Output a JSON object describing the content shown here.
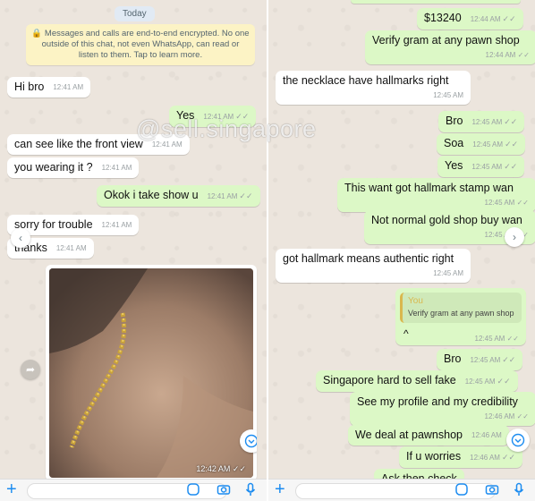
{
  "left": {
    "day_label": "Today",
    "encryption_notice": "Messages and calls are end-to-end encrypted. No one outside of this chat, not even WhatsApp, can read or listen to them. Tap to learn more.",
    "messages": [
      {
        "text": "Hi bro",
        "time": "12:41 AM"
      },
      {
        "text": "Yes",
        "time": "12:41 AM"
      },
      {
        "text": "can see like the front view",
        "time": "12:41 AM"
      },
      {
        "text": "you wearing it ?",
        "time": "12:41 AM"
      },
      {
        "text": "Okok i take show u",
        "time": "12:41 AM"
      },
      {
        "text": "sorry for trouble",
        "time": "12:41 AM"
      },
      {
        "text": "thanks",
        "time": "12:41 AM"
      }
    ],
    "photo_time": "12:42 AM"
  },
  "right": {
    "messages": [
      {
        "text": "$13240",
        "time": "12:44 AM"
      },
      {
        "text": "Verify gram at any pawn shop",
        "time": "12:44 AM"
      },
      {
        "text": "the necklace have hallmarks right",
        "time": "12:45 AM"
      },
      {
        "text": "Bro",
        "time": "12:45 AM"
      },
      {
        "text": "Soa",
        "time": "12:45 AM"
      },
      {
        "text": "Yes",
        "time": "12:45 AM"
      },
      {
        "text": "This want got hallmark stamp wan",
        "time": "12:45 AM"
      },
      {
        "text": "Not normal gold shop buy wan",
        "time": "12:45 AM"
      },
      {
        "text": "got hallmark means authentic right",
        "time": "12:45 AM"
      },
      {
        "text": "^",
        "time": "12:45 AM"
      },
      {
        "text": "Bro",
        "time": "12:45 AM"
      },
      {
        "text": "Singapore hard to sell fake",
        "time": "12:45 AM"
      },
      {
        "text": "See my profile and my credibility",
        "time": "12:46 AM"
      },
      {
        "text": "We deal at pawnshop",
        "time": "12:46 AM"
      },
      {
        "text": "If u worries",
        "time": "12:46 AM"
      },
      {
        "text": "Ask then check",
        "time": ""
      }
    ],
    "quote": {
      "author": "You",
      "text": "Verify gram at any pawn shop"
    }
  },
  "watermark": "@sell.singapore",
  "colors": {
    "outgoing": "#dcf8c6",
    "incoming": "#ffffff",
    "accent": "#1c8cf0"
  },
  "icons": [
    "lock-icon",
    "double-check-icon",
    "share-icon",
    "chevron-left-icon",
    "chevron-right-icon",
    "chevron-down-icon",
    "plus-icon",
    "sticker-icon",
    "camera-icon",
    "mic-icon"
  ]
}
